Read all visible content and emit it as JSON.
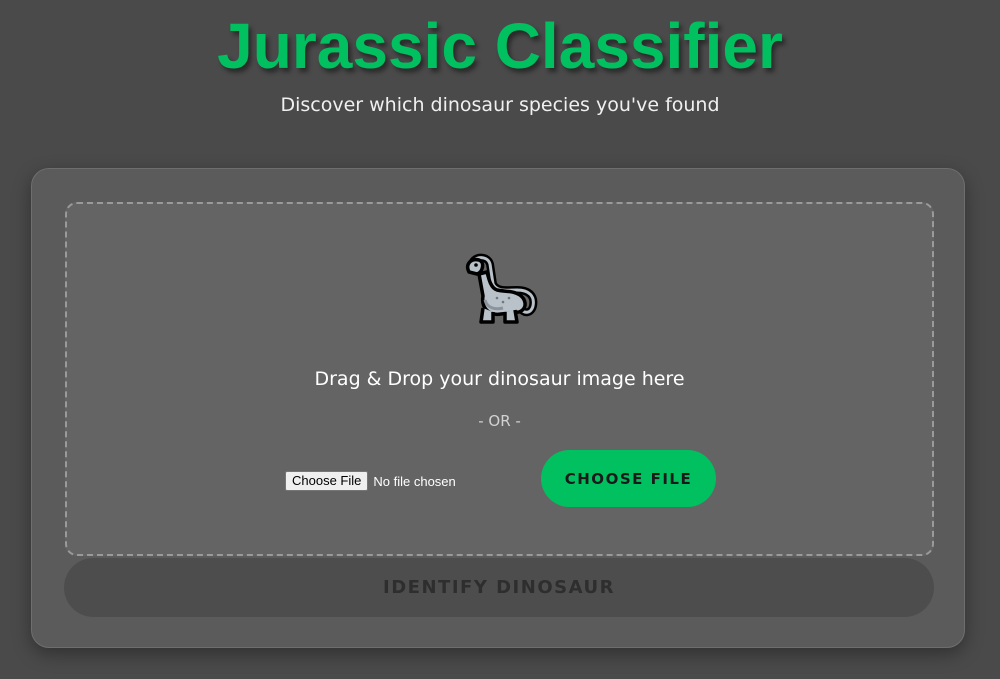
{
  "header": {
    "title": "Jurassic Classifier",
    "subtitle": "Discover which dinosaur species you've found"
  },
  "upload": {
    "icon": "dinosaur-icon",
    "drop_text": "Drag & Drop your dinosaur image here",
    "or_text": "- OR -",
    "native_input": {
      "button_label": "Choose File",
      "status": "No file chosen"
    },
    "choose_button_label": "CHOOSE FILE"
  },
  "actions": {
    "identify_label": "IDENTIFY DINOSAUR"
  },
  "colors": {
    "accent": "#00c060",
    "background": "#4a4a4a",
    "card": "#5b5b5b",
    "dropzone": "#646464"
  }
}
